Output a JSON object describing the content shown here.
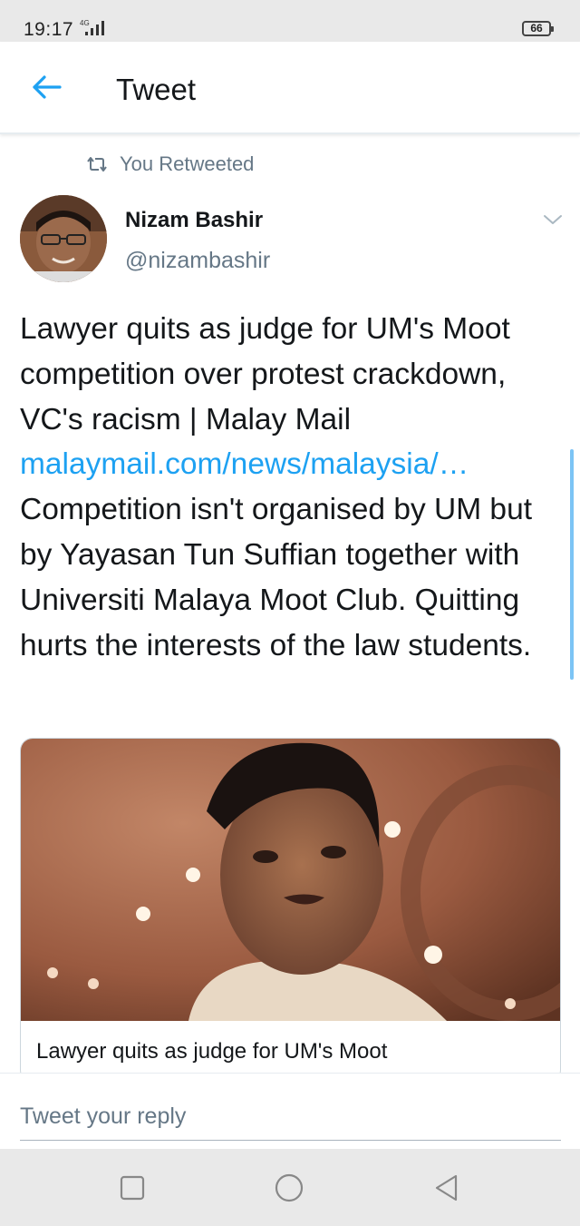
{
  "status_bar": {
    "time": "19:17",
    "network": "4G",
    "battery": "66"
  },
  "header": {
    "title": "Tweet",
    "back_icon": "arrow-left-icon",
    "accent_color": "#1da1f2"
  },
  "retweet": {
    "label": "You Retweeted",
    "icon": "retweet-icon"
  },
  "tweet": {
    "author_name": "Nizam Bashir",
    "author_handle": "@nizambashir",
    "text_before_link": "Lawyer quits as judge for UM's Moot competition over protest crackdown, VC's racism | Malay Mail ",
    "link_text": "malaymail.com/news/malaysia/…",
    "text_after_link": " Competition isn't organised by UM but by Yayasan Tun Suffian together with Universiti Malaya Moot Club. Quitting hurts the interests of the law students."
  },
  "card": {
    "title": "Lawyer quits as judge for UM's Moot"
  },
  "reply": {
    "placeholder": "Tweet your reply"
  },
  "nav_bar": {
    "icons": [
      "square-recents-icon",
      "circle-home-icon",
      "triangle-back-icon"
    ]
  }
}
